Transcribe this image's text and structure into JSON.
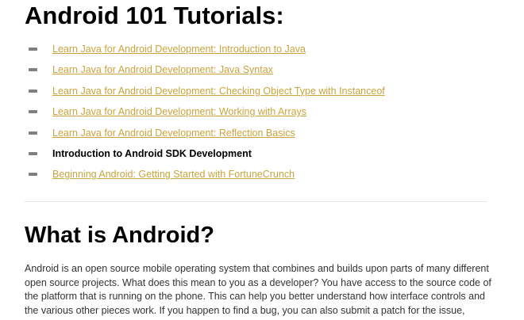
{
  "page": {
    "heading": "Android 101 Tutorials:",
    "tutorials": [
      {
        "label": "Learn Java for Android Development: Introduction to Java",
        "link": true
      },
      {
        "label": "Learn Java for Android Development: Java Syntax",
        "link": true
      },
      {
        "label": "Learn Java for Android Development: Checking Object Type with Instanceof",
        "link": true
      },
      {
        "label": "Learn Java for Android Development: Working with Arrays",
        "link": true
      },
      {
        "label": "Learn Java for Android Development: Reflection Basics",
        "link": true
      },
      {
        "label": "Introduction to Android SDK Development",
        "link": false
      },
      {
        "label": "Beginning Android: Getting Started with FortuneCrunch",
        "link": true
      }
    ],
    "section_title": "What is Android?",
    "paragraph_lines": [
      "Android is an open source mobile operating system that combines and builds upon parts of many different",
      "open source projects. What does this mean to you as a developer? You have access to the source code of",
      "the platform that is running on the phone. This can help you better understand how interface controls and",
      "the various other pieces work. If you happen to find a bug, you can also submit a patch for the issue,"
    ]
  },
  "colors": {
    "link": "#c9a43c",
    "heading": "#000000",
    "body_text": "#333333",
    "bullet": "#808080",
    "divider": "#e4e4e4"
  }
}
